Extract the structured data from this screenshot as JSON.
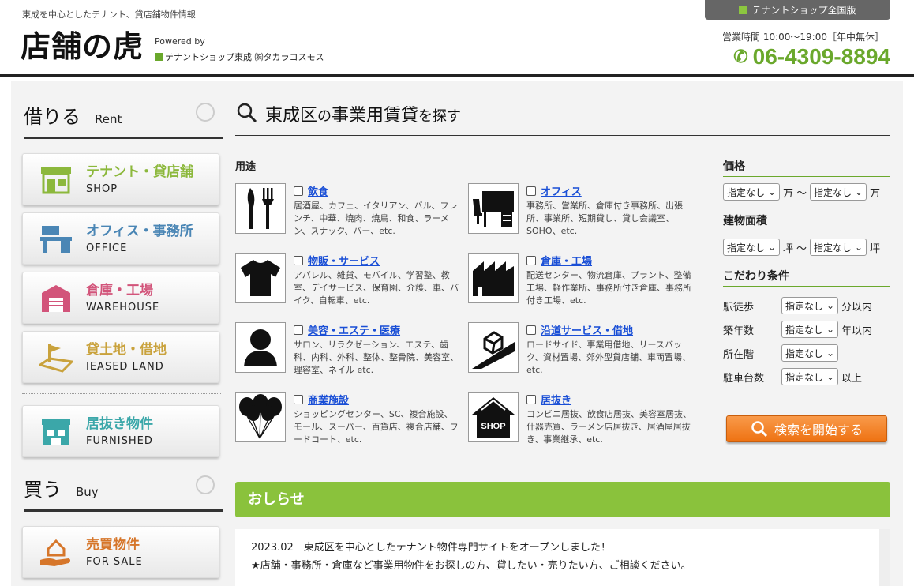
{
  "header": {
    "tagline": "東成を中心としたテナント、貸店舗物件情報",
    "logo": "店舗の虎",
    "powered_by": "Powered by",
    "company": "テナントショップ東成 ㈱タカラコスモス",
    "national_link": "テナントショップ全国版",
    "hours": "営業時間 10:00〜19:00［年中無休］",
    "phone": "06-4309-8894"
  },
  "sidebar": {
    "rent_heading": {
      "jp": "借りる",
      "en": "Rent"
    },
    "rent_items": [
      {
        "jp": "テナント・貸店舗",
        "en": "SHOP",
        "color": "#8cb83c",
        "icon": "storefront-icon"
      },
      {
        "jp": "オフィス・事務所",
        "en": "OFFICE",
        "color": "#4a86b5",
        "icon": "office-desk-icon"
      },
      {
        "jp": "倉庫・工場",
        "en": "WAREHOUSE",
        "color": "#d2547a",
        "icon": "warehouse-icon"
      },
      {
        "jp": "貸土地・借地",
        "en": "IEASED LAND",
        "color": "#c9a23c",
        "icon": "land-flag-icon"
      }
    ],
    "furnished": {
      "jp": "居抜き物件",
      "en": "FURNISHED",
      "color": "#3ba7a9",
      "icon": "furnished-shop-icon"
    },
    "buy_heading": {
      "jp": "買う",
      "en": "Buy"
    },
    "buy_items": [
      {
        "jp": "売買物件",
        "en": "FOR SALE",
        "color": "#d6762a",
        "icon": "house-hand-icon"
      }
    ]
  },
  "search": {
    "title_area": "東成区",
    "title_no": "の",
    "title_rest": "事業用賃貸",
    "title_suffix": "を探す",
    "usage_heading": "用途",
    "categories": [
      {
        "title": "飲食",
        "desc": "居酒屋、カフェ、イタリアン、バル、フレンチ、中華、焼肉、焼鳥、和食、ラーメン、スナック、バー、etc.",
        "icon": "fork-knife-icon"
      },
      {
        "title": "オフィス",
        "desc": "事務所、営業所、倉庫付き事務所、出張所、事業所、短期貸し、貸し会議室、SOHO、etc.",
        "icon": "office-desk-icon"
      },
      {
        "title": "物販・サービス",
        "desc": "アパレル、雑貨、モバイル、学習塾、教室、デイサービス、保育園、介護、車、バイク、自転車、etc.",
        "icon": "tshirt-icon"
      },
      {
        "title": "倉庫・工場",
        "desc": "配送センター、物流倉庫、プラント、整備工場、軽作業所、事務所付き倉庫、事務所付き工場、etc.",
        "icon": "factory-icon"
      },
      {
        "title": "美容・エステ・医療",
        "desc": "サロン、リラクゼーション、エステ、歯科、内科、外科、整体、整骨院、美容室、理容室、ネイル etc.",
        "icon": "person-icon"
      },
      {
        "title": "沿道サービス・借地",
        "desc": "ロードサイド、事業用借地、リースバック、資材置場、郊外型貸店舗、車両置場、etc.",
        "icon": "roadside-icon"
      },
      {
        "title": "商業施設",
        "desc": "ショッピングセンター、SC、複合施設、モール、スーパー、百貨店、複合店舗、フードコート、etc.",
        "icon": "balloons-icon"
      },
      {
        "title": "居抜き",
        "desc": "コンビニ居抜、飲食店居抜、美容室居抜、什器売買、ラーメン店居抜き、居酒屋居抜き、事業継承、etc.",
        "icon": "shop-house-icon"
      }
    ],
    "shop_icon_text": "SHOP"
  },
  "filters": {
    "price_heading": "価格",
    "area_heading": "建物面積",
    "cond_heading": "こだわり条件",
    "select_default": "指定なし",
    "unit_man": "万",
    "unit_tsubo": "坪",
    "range_sep": "〜",
    "walk_label": "駅徒歩",
    "walk_suffix": "分以内",
    "age_label": "築年数",
    "age_suffix": "年以内",
    "floor_label": "所在階",
    "parking_label": "駐車台数",
    "parking_suffix": "以上",
    "search_button": "検索を開始する"
  },
  "news": {
    "heading": "おしらせ",
    "line1": "2023.02　東成区を中心としたテナント物件専門サイトをオープンしました！",
    "line2": "★店舗・事務所・倉庫など事業用物件をお探しの方、貸したい・売りたい方、ご相談ください。"
  }
}
